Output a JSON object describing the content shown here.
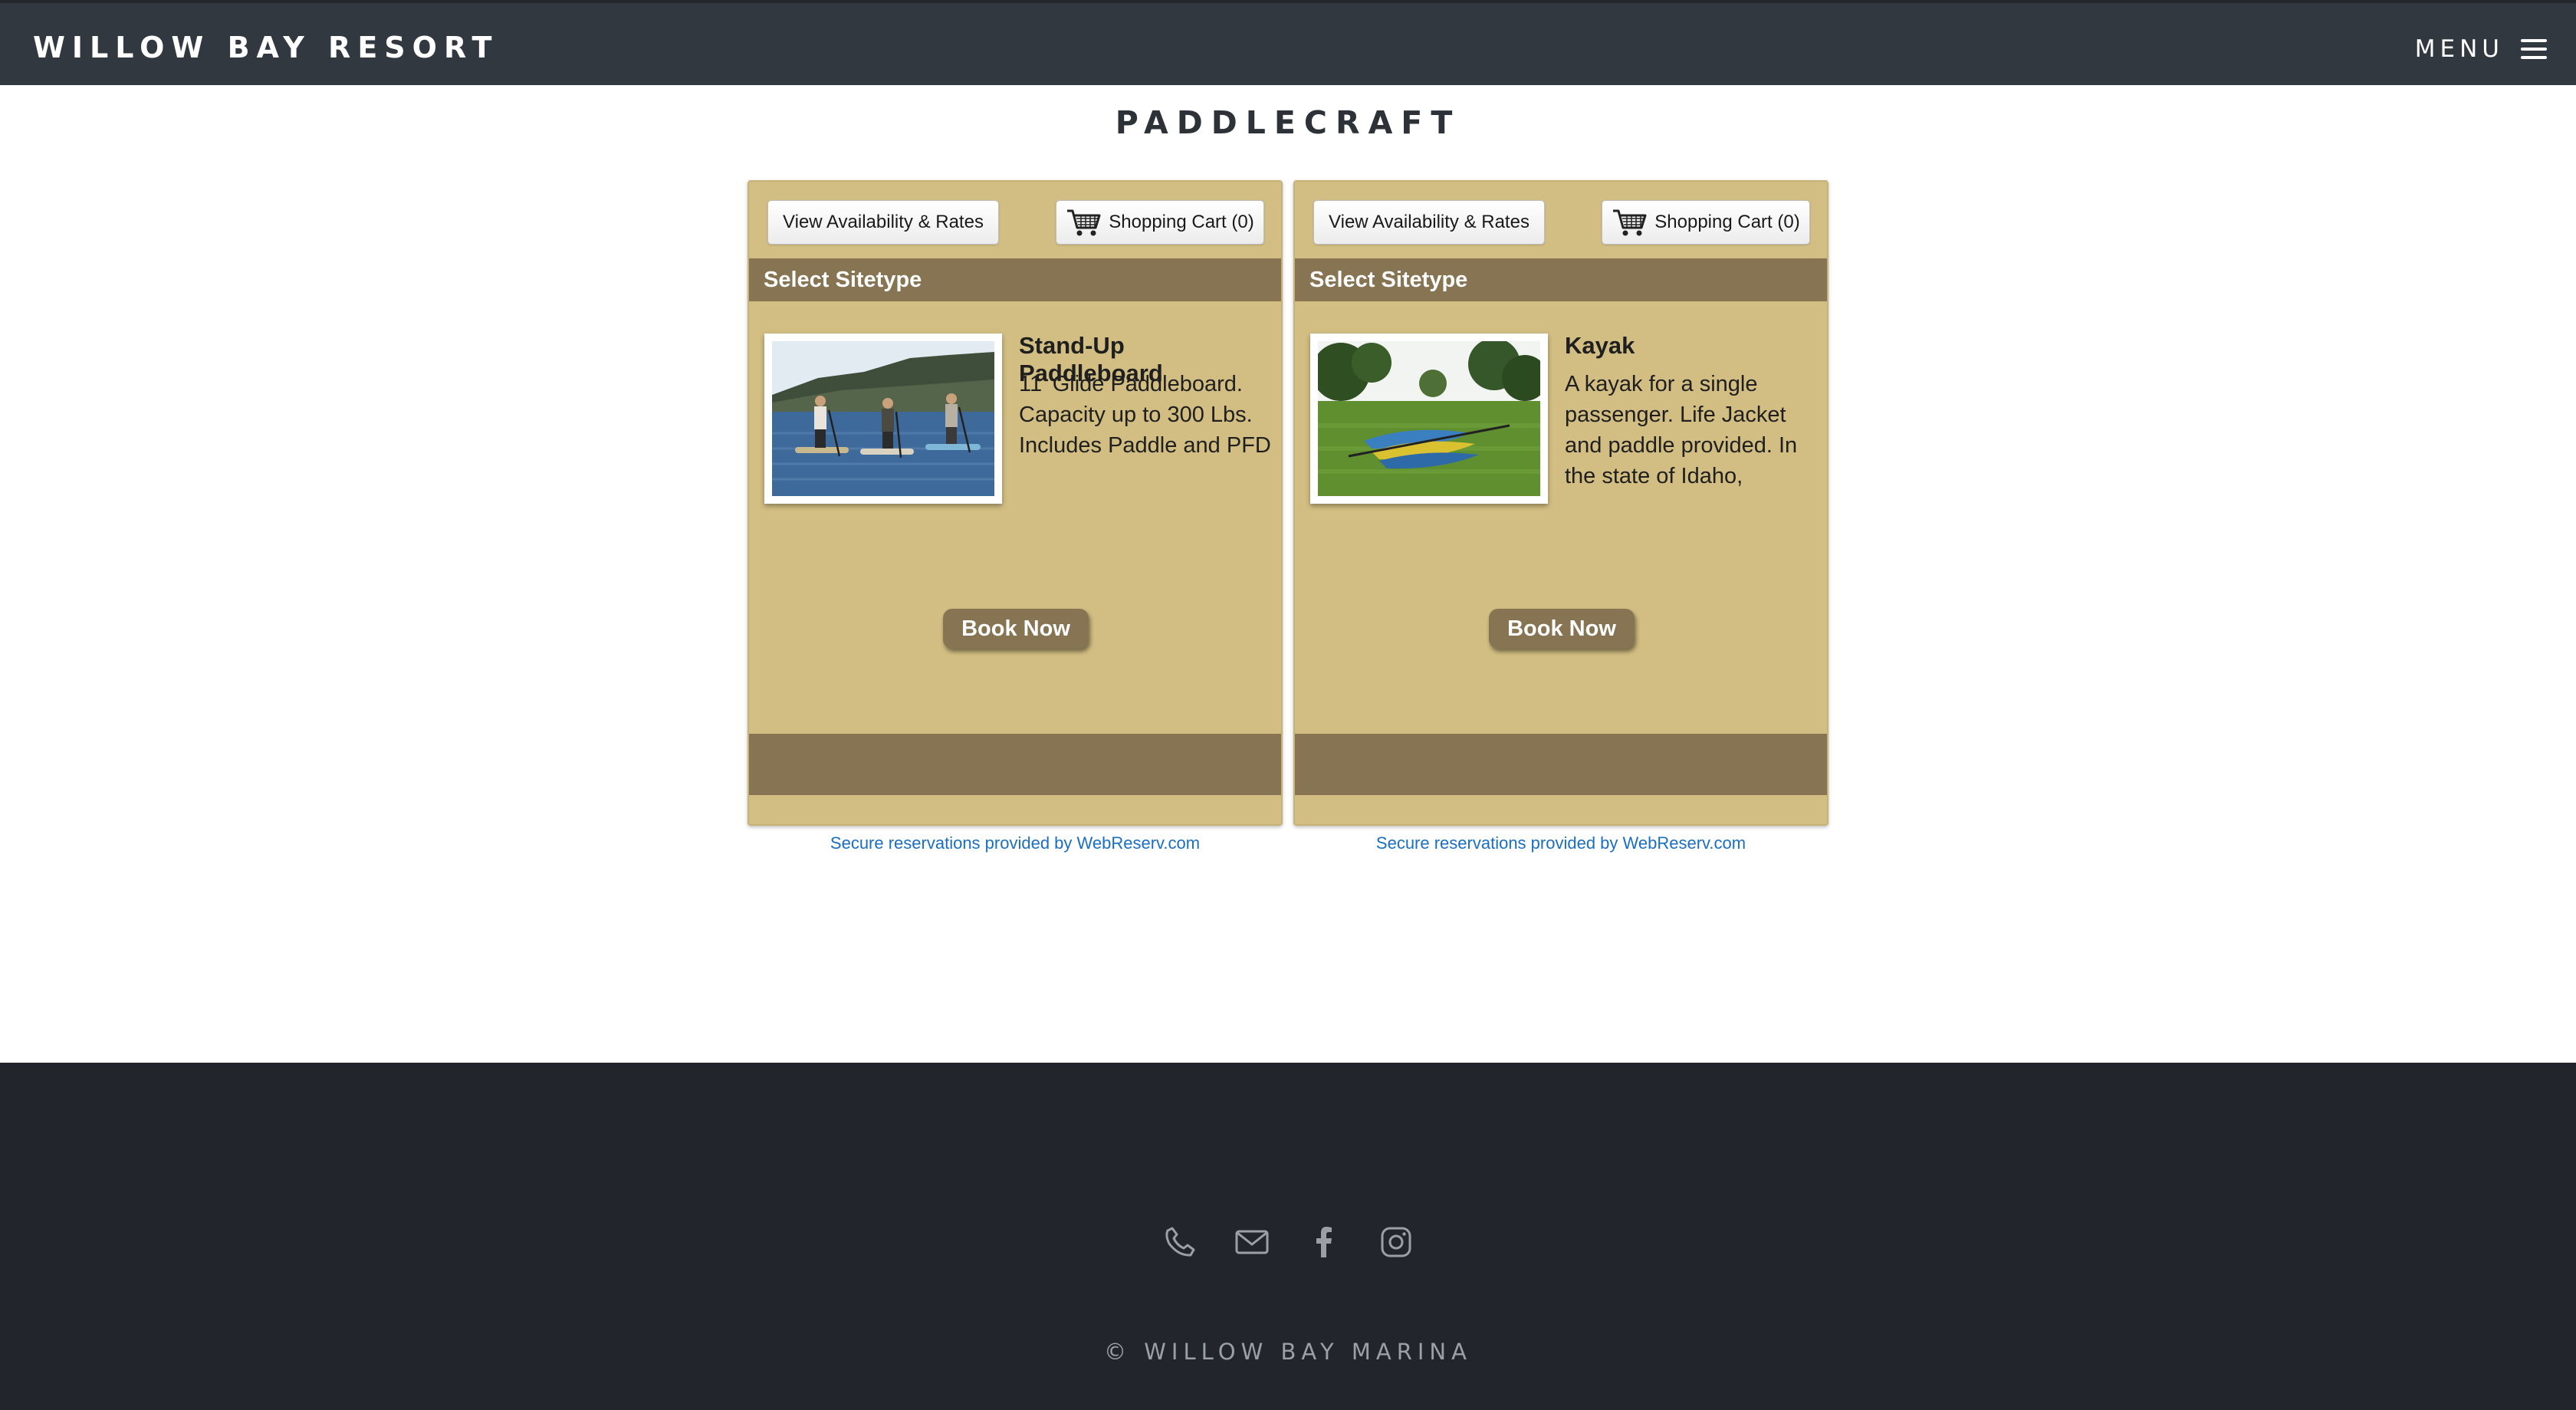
{
  "header": {
    "brand": "WILLOW BAY RESORT",
    "menu_label": "MENU"
  },
  "page": {
    "title": "PADDLECRAFT"
  },
  "panels": [
    {
      "availability_label": "View Availability & Rates",
      "cart_label": "Shopping Cart (0)",
      "section_label": "Select Sitetype",
      "item_title": "Stand-Up Paddleboard",
      "item_description": "11' Glide Paddleboard. Capacity up to 300 Lbs. Includes Paddle and PFD",
      "book_label": "Book Now",
      "secure_text": "Secure reservations provided by WebReserv.com"
    },
    {
      "availability_label": "View Availability & Rates",
      "cart_label": "Shopping Cart (0)",
      "section_label": "Select Sitetype",
      "item_title": "Kayak",
      "item_description": "A kayak for a single passenger. Life Jacket and paddle provided. In the state of Idaho,",
      "book_label": "Book Now",
      "secure_text": "Secure reservations provided by WebReserv.com"
    }
  ],
  "footer": {
    "icons": [
      "phone-icon",
      "mail-icon",
      "facebook-icon",
      "instagram-icon"
    ],
    "copyright": "© WILLOW BAY MARINA"
  },
  "colors": {
    "header_bg": "#323840",
    "panel_bg": "#d2be82",
    "panel_bar": "#877452",
    "link": "#1a6fc2",
    "footer_bg": "#22262c"
  }
}
